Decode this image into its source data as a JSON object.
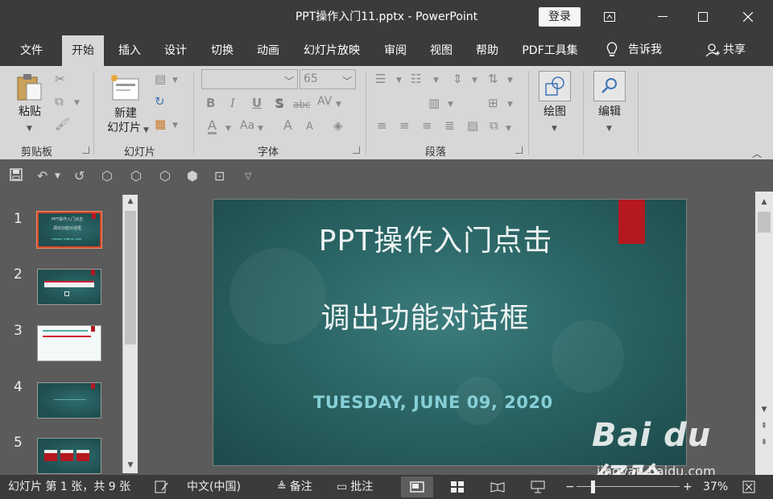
{
  "window": {
    "title": "PPT操作入门11.pptx  -  PowerPoint",
    "login_label": "登录"
  },
  "menu": {
    "tabs": [
      "文件",
      "开始",
      "插入",
      "设计",
      "切换",
      "动画",
      "幻灯片放映",
      "审阅",
      "视图",
      "帮助",
      "PDF工具集"
    ],
    "active_tab": "开始",
    "tell_me": "告诉我",
    "share": "共享"
  },
  "ribbon": {
    "clipboard": {
      "paste": "粘贴",
      "group": "剪贴板"
    },
    "slides": {
      "new_slide_1": "新建",
      "new_slide_2": "幻灯片",
      "group": "幻灯片"
    },
    "font": {
      "font_name": "",
      "font_size": "65",
      "group": "字体",
      "bold": "B",
      "italic": "I",
      "underline": "U",
      "shadow": "S",
      "strike": "abc",
      "spacing": "AV",
      "font_color": "A",
      "change_case": "Aa",
      "grow": "A",
      "shrink": "A"
    },
    "paragraph": {
      "group": "段落"
    },
    "drawing": {
      "label": "绘图"
    },
    "editing": {
      "label": "编辑"
    }
  },
  "thumbnails": [
    {
      "num": "1",
      "style": "teal",
      "selected": true,
      "line1": "PPT操作入门点击",
      "line2": "调出功能对话框",
      "line3": "TUESDAY, JUNE 09, 2020"
    },
    {
      "num": "2",
      "style": "teal",
      "selected": false
    },
    {
      "num": "3",
      "style": "light",
      "selected": false
    },
    {
      "num": "4",
      "style": "teal",
      "selected": false
    },
    {
      "num": "5",
      "style": "teal",
      "selected": false
    }
  ],
  "slide": {
    "title_line1": "PPT操作入门点击",
    "title_line2": "调出功能对话框",
    "date": "TUESDAY, JUNE 09, 2020"
  },
  "watermark": {
    "text": "Bai du 经验",
    "sub": "jingyan.baidu.com"
  },
  "status": {
    "slide_info": "幻灯片 第 1 张，共 9 张",
    "language": "中文(中国)",
    "notes": "备注",
    "comments": "批注",
    "zoom": "37%"
  },
  "colors": {
    "accent": "#d24726",
    "slide_bg": "#2b6565",
    "date_color": "#87cfd7",
    "tag_red": "#b3191f"
  }
}
